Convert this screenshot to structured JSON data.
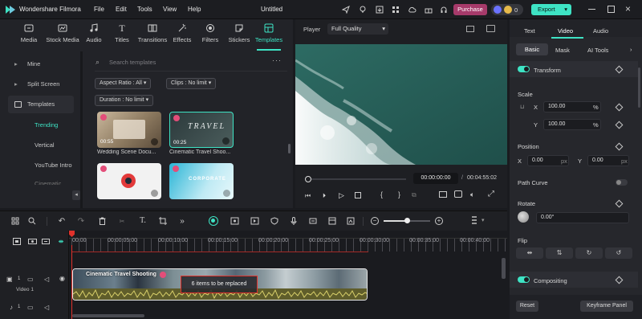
{
  "app": {
    "name": "Wondershare Filmora",
    "title": "Untitled"
  },
  "menu": [
    "File",
    "Edit",
    "Tools",
    "View",
    "Help"
  ],
  "titlebar": {
    "purchase": "Purchase",
    "credits": "0",
    "export": "Export"
  },
  "assetbar": {
    "tools": [
      {
        "label": "Media",
        "icon": "media-icon"
      },
      {
        "label": "Stock Media",
        "icon": "stock-media-icon"
      },
      {
        "label": "Audio",
        "icon": "audio-icon"
      },
      {
        "label": "Titles",
        "icon": "titles-icon"
      },
      {
        "label": "Transitions",
        "icon": "transitions-icon"
      },
      {
        "label": "Effects",
        "icon": "effects-icon"
      },
      {
        "label": "Filters",
        "icon": "filters-icon"
      },
      {
        "label": "Stickers",
        "icon": "stickers-icon"
      },
      {
        "label": "Templates",
        "icon": "templates-icon",
        "active": true
      }
    ]
  },
  "leftnav": {
    "items": [
      "Mine",
      "Split Screen",
      "Templates"
    ],
    "subitems": [
      "Trending",
      "Vertical",
      "YouTube Intro",
      "Cinematic"
    ]
  },
  "templates": {
    "search_placeholder": "Search templates",
    "filters": [
      "Aspect Ratio : All",
      "Clips : No limit",
      "Duration : No limit"
    ],
    "cards": [
      {
        "label": "Wedding Scene Docu...",
        "duration": "00:55"
      },
      {
        "label": "Cinematic Travel Shoo...",
        "duration": "00:25"
      },
      {
        "label": "",
        "duration": ""
      },
      {
        "label": "",
        "duration": ""
      }
    ],
    "card2_title": "TRAVEL",
    "card4_title": "CORPORATE"
  },
  "player": {
    "label": "Player",
    "quality": "Full Quality",
    "current_time": "00:00:00:00",
    "total_time": "00:04:55:02"
  },
  "rpanel": {
    "tabs": [
      "Text",
      "Video",
      "Audio"
    ],
    "active_tab": "Video",
    "subtabs": [
      "Basic",
      "Mask",
      "AI Tools"
    ],
    "transform": "Transform",
    "scale": "Scale",
    "scale_x_label": "X",
    "scale_x": "100.00",
    "scale_y_label": "Y",
    "scale_y": "100.00",
    "percent": "%",
    "position": "Position",
    "pos_x_label": "X",
    "pos_x": "0.00",
    "pos_y_label": "Y",
    "pos_y": "0.00",
    "px": "px",
    "path_curve": "Path Curve",
    "rotate": "Rotate",
    "rotate_value": "0.00°",
    "flip": "Flip",
    "compositing": "Compositing",
    "reset": "Reset",
    "keyframe_panel": "Keyframe Panel"
  },
  "timeline": {
    "ticks": [
      "00:00",
      "00:00:05:00",
      "00:00:10:00",
      "00:00:15:00",
      "00:00:20:00",
      "00:00:25:00",
      "00:00:30:00",
      "00:00:35:00",
      "00:00:40:00"
    ],
    "clip_title": "Cinematic Travel Shooting",
    "replace_notice": "6 items to be replaced",
    "video_track_label": "Video 1",
    "track_numbers": [
      "1",
      "1"
    ]
  },
  "colors": {
    "accent": "#3ee3c4",
    "purchase": "#a63a6a",
    "clip_border": "#e0e0e0",
    "highlight": "#e0312b"
  }
}
